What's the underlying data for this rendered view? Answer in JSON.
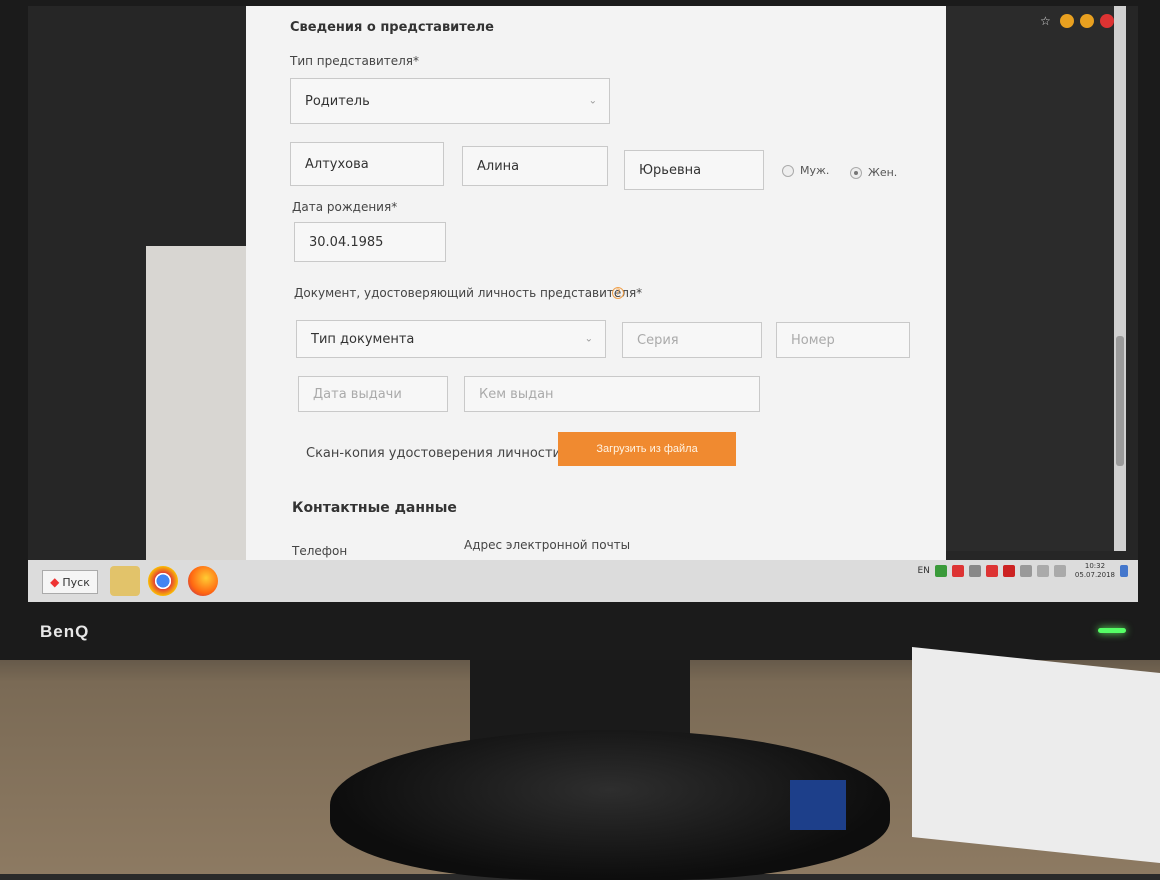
{
  "form": {
    "representative_section_title": "Сведения о представителе",
    "rep_type_label": "Тип представителя*",
    "rep_type_value": "Родитель",
    "last_name": "Алтухова",
    "first_name": "Алина",
    "middle_name": "Юрьевна",
    "gender_male": "Муж.",
    "gender_female": "Жен.",
    "gender_selected": "female",
    "birthdate_label": "Дата рождения*",
    "birthdate_value": "30.04.1985",
    "document_label": "Документ, удостоверяющий личность представителя*",
    "doc_type_placeholder": "Тип документа",
    "series_placeholder": "Серия",
    "number_placeholder": "Номер",
    "issue_date_placeholder": "Дата выдачи",
    "issued_by_placeholder": "Кем выдан",
    "scan_label": "Скан-копия удостоверения личности",
    "upload_button": "Загрузить из файла",
    "contacts_title": "Контактные данные",
    "phone_label": "Телефон",
    "email_label": "Адрес электронной почты",
    "help_glyph": "?"
  },
  "taskbar": {
    "start_label": "Пуск",
    "lang": "EN",
    "time": "10:32",
    "date": "05.07.2018"
  },
  "monitor": {
    "brand": "BenQ"
  },
  "colors": {
    "accent": "#f08a30",
    "page_bg": "#f3f3f3"
  }
}
